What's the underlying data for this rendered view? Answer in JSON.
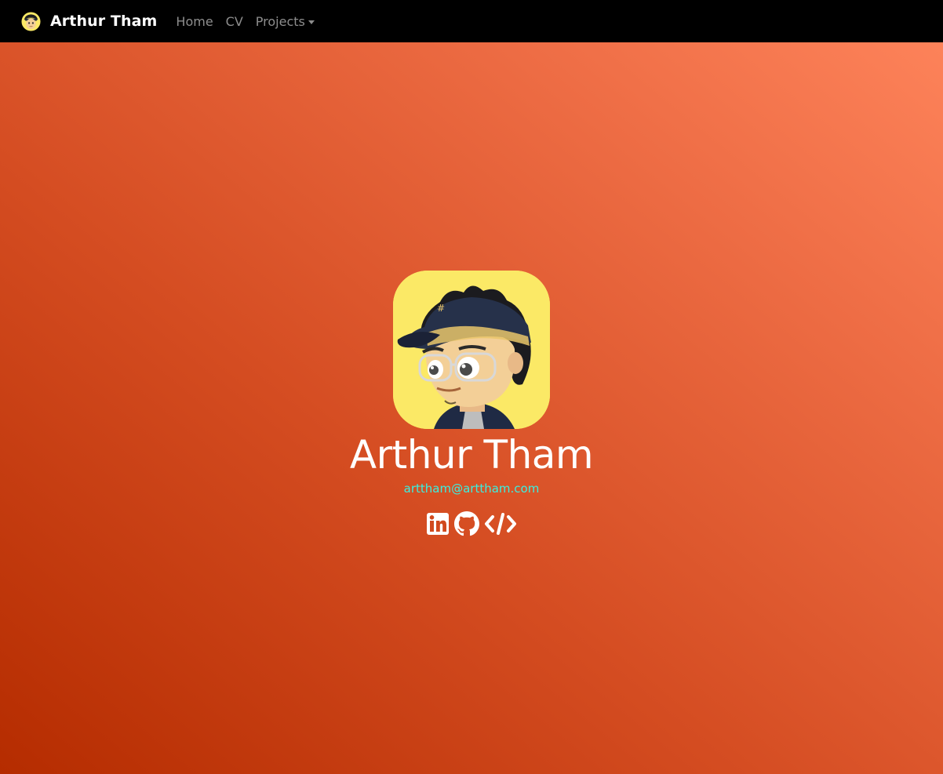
{
  "navbar": {
    "brand": "Arthur Tham",
    "links": [
      {
        "label": "Home"
      },
      {
        "label": "CV"
      },
      {
        "label": "Projects"
      }
    ]
  },
  "profile": {
    "name": "Arthur Tham",
    "email": "arttham@arttham.com",
    "email_color": "#39f0e0",
    "avatar_bg": "#fbe966"
  },
  "social": [
    {
      "icon": "linkedin-icon"
    },
    {
      "icon": "github-icon"
    },
    {
      "icon": "code-icon"
    }
  ],
  "colors": {
    "navbar_bg": "#000000",
    "gradient_start": "#b52c00",
    "gradient_end": "#ff855c"
  }
}
